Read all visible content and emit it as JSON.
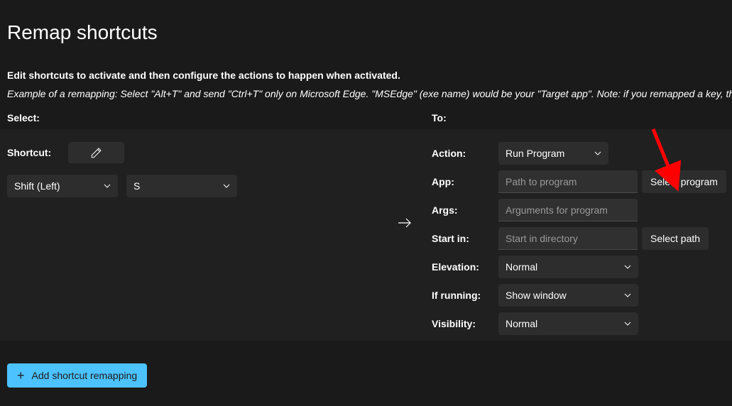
{
  "title": "Remap shortcuts",
  "instructions": "Edit shortcuts to activate and then configure the actions to happen when activated.",
  "example": "Example of a remapping: Select \"Alt+T\" and send \"Ctrl+T\" only on Microsoft Edge. \"MSEdge\" (exe name) would be your \"Target app\". Note: if you remapped a key, that wi",
  "headers": {
    "select": "Select:",
    "to": "To:"
  },
  "left": {
    "shortcut_label": "Shortcut:",
    "key1": "Shift (Left)",
    "key2": "S"
  },
  "right": {
    "action_label": "Action:",
    "action_value": "Run Program",
    "app_label": "App:",
    "app_placeholder": "Path to program",
    "select_program": "Select program",
    "args_label": "Args:",
    "args_placeholder": "Arguments for program",
    "startin_label": "Start in:",
    "startin_placeholder": "Start in directory",
    "select_path": "Select path",
    "elevation_label": "Elevation:",
    "elevation_value": "Normal",
    "ifrunning_label": "If running:",
    "ifrunning_value": "Show window",
    "visibility_label": "Visibility:",
    "visibility_value": "Normal"
  },
  "add_button": "Add shortcut remapping"
}
